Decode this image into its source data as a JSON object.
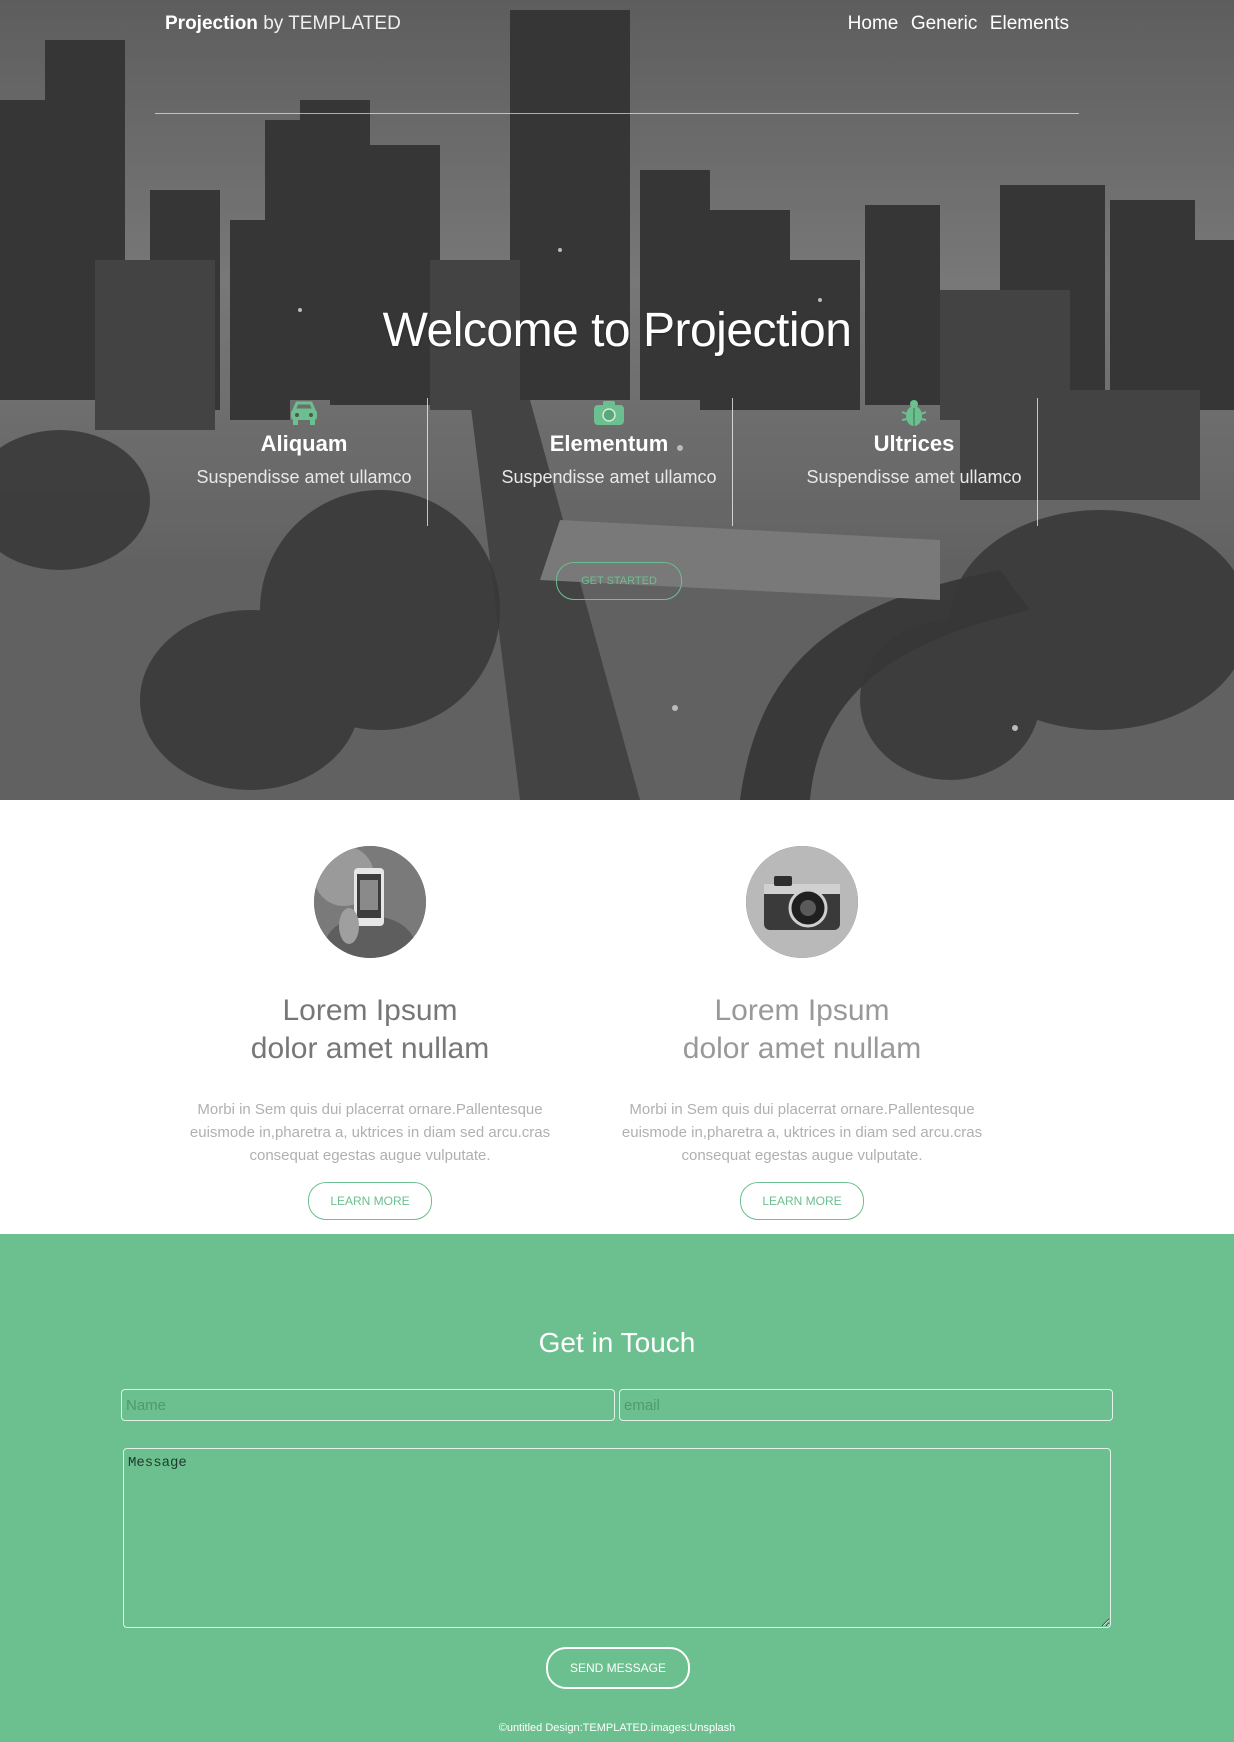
{
  "nav": {
    "brand_bold": "Projection",
    "brand_rest": "by TEMPLATED",
    "links": [
      "Home",
      "Generic",
      "Elements"
    ]
  },
  "hero": {
    "title": "Welcome to Projection",
    "features": [
      {
        "icon": "car-icon",
        "title": "Aliquam",
        "desc": "Suspendisse amet ullamco"
      },
      {
        "icon": "camera-icon",
        "title": "Elementum",
        "desc": "Suspendisse amet ullamco"
      },
      {
        "icon": "bug-icon",
        "title": "Ultrices",
        "desc": "Suspendisse amet ullamco"
      }
    ],
    "cta": "GET STARTED"
  },
  "cards": [
    {
      "title_line1": "Lorem Ipsum",
      "title_line2": "dolor amet nullam",
      "body": "Morbi in Sem quis dui placerrat ornare.Pallentesque euismode in,pharetra a, uktrices in diam sed arcu.cras consequat egestas augue vulputate.",
      "button": "LEARN MORE",
      "image": "phone-photo"
    },
    {
      "title_line1": "Lorem Ipsum",
      "title_line2": "dolor amet nullam",
      "body": "Morbi in Sem quis dui placerrat ornare.Pallentesque euismode in,pharetra a, uktrices in diam sed arcu.cras consequat egestas augue vulputate.",
      "button": "LEARN MORE",
      "image": "camera-photo"
    }
  ],
  "contact": {
    "title": "Get in Touch",
    "name_placeholder": "Name",
    "email_placeholder": "email",
    "message_placeholder": "Message",
    "send": "SEND MESSAGE"
  },
  "footer": "©untitled Design:TEMPLATED.images:Unsplash",
  "colors": {
    "accent": "#6cbf8f",
    "card_title_dark": "#777777",
    "card_title_light": "#999999"
  }
}
